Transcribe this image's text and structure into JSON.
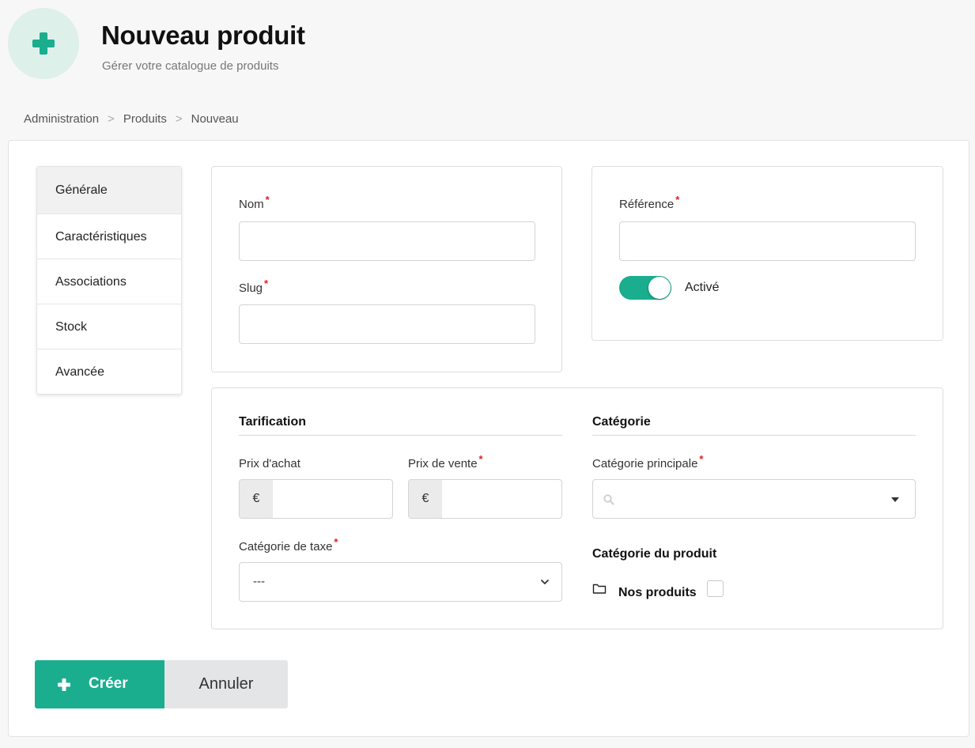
{
  "header": {
    "title": "Nouveau produit",
    "subtitle": "Gérer votre catalogue de produits",
    "icon": "plus-icon",
    "accent_color": "#1aae8f"
  },
  "breadcrumb": [
    "Administration",
    "Produits",
    "Nouveau"
  ],
  "tabs": [
    {
      "label": "Générale",
      "active": true
    },
    {
      "label": "Caractéristiques",
      "active": false
    },
    {
      "label": "Associations",
      "active": false
    },
    {
      "label": "Stock",
      "active": false
    },
    {
      "label": "Avancée",
      "active": false
    }
  ],
  "general": {
    "name_label": "Nom",
    "name_value": "",
    "slug_label": "Slug",
    "slug_value": "",
    "reference_label": "Référence",
    "reference_value": "",
    "enabled_label": "Activé",
    "enabled": true,
    "required_mark": "*"
  },
  "pricing": {
    "title": "Tarification",
    "purchase_price_label": "Prix d'achat",
    "sale_price_label": "Prix de vente",
    "currency_symbol": "€",
    "tax_category_label": "Catégorie de taxe",
    "tax_category_value": "---"
  },
  "category": {
    "title": "Catégorie",
    "main_category_label": "Catégorie principale",
    "main_category_value": "",
    "product_category_label": "Catégorie du produit",
    "items": [
      {
        "label": "Nos produits",
        "checked": false
      }
    ]
  },
  "actions": {
    "create_label": "Créer",
    "cancel_label": "Annuler"
  }
}
